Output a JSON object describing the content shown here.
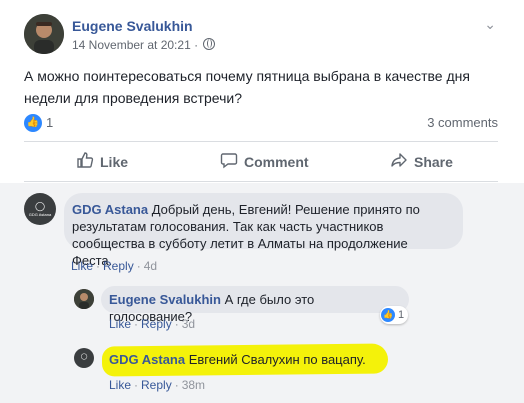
{
  "post": {
    "author": "Eugene Svalukhin",
    "timestamp": "14 November at 20:21 ·",
    "text": "А можно поинтересоваться почему пятница выбрана в качестве дня недели для проведения встречи?",
    "like_count": "1",
    "comments_count": "3 comments"
  },
  "actions": {
    "like": "Like",
    "comment": "Comment",
    "share": "Share"
  },
  "comments": [
    {
      "author": "GDG Astana",
      "text": "Добрый день, Евгений! Решение принято по результатам голосования. Так как часть участников сообщества в субботу летит в Алматы на продолжение Феста.",
      "like": "Like",
      "reply": "Reply",
      "time": "4d"
    },
    {
      "author": "Eugene Svalukhin",
      "text": "А где было это голосование?",
      "like": "Like",
      "reply": "Reply",
      "time": "3d",
      "reaction_count": "1"
    },
    {
      "author": "GDG Astana",
      "text": "Евгений Свалухин по вацапу.",
      "like": "Like",
      "reply": "Reply",
      "time": "38m"
    }
  ],
  "colors": {
    "link": "#385898",
    "like_blue": "#2d88ff",
    "highlight": "#f4f20a",
    "comment_bg": "#f2f3f5"
  },
  "icons": [
    "globe-icon",
    "chevron-down-icon",
    "thumbs-up-icon",
    "speech-bubble-icon",
    "share-arrow-icon",
    "bulb-icon"
  ]
}
